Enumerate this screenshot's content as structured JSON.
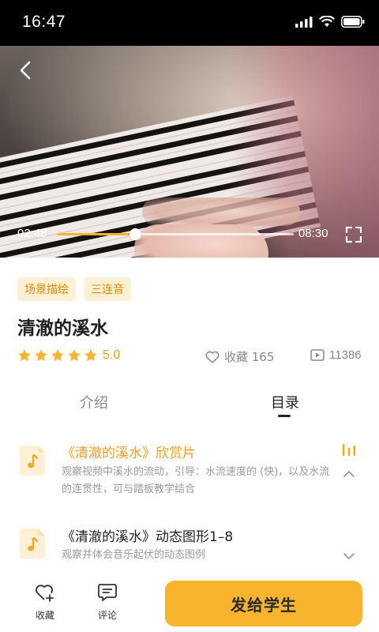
{
  "status_bar": {
    "time": "16:47"
  },
  "player": {
    "current_time": "02:48",
    "total_time": "08:30",
    "progress": 0.33
  },
  "course": {
    "tags": [
      "场景描绘",
      "三连音"
    ],
    "title": "清澈的溪水",
    "rating": "5.0",
    "star_count": 5,
    "favorites_label": "收藏 165",
    "views": "11386"
  },
  "tabs": {
    "intro": "介绍",
    "catalog": "目录",
    "active": "catalog"
  },
  "catalog": [
    {
      "title": "《清澈的溪水》欣赏片",
      "desc": "观察视频中溪水的流动，引导：水流速度的 (快)，以及水流的连贯性，可与踏板教学结合",
      "active": true
    },
    {
      "title": "《清澈的溪水》动态图形1–8",
      "desc": "观察并体会音乐起伏的动态图例",
      "active": false
    }
  ],
  "bottom_bar": {
    "favorite_label": "收藏",
    "comment_label": "评论",
    "send_label": "发给学生"
  },
  "colors": {
    "accent": "#f7b42c",
    "accent_text": "#f0a020",
    "tag_bg": "#fdf0d4"
  }
}
